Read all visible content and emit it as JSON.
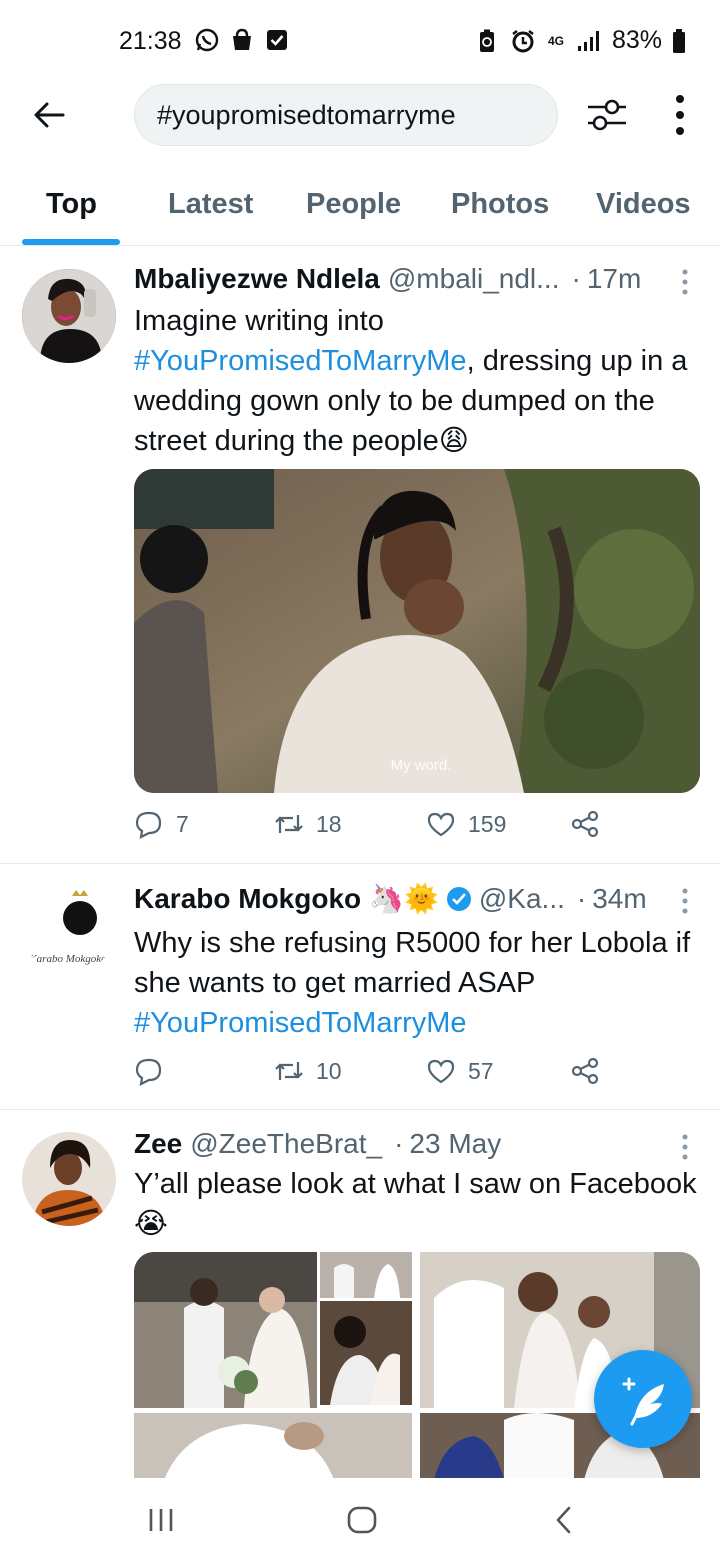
{
  "status_bar": {
    "time": "21:38",
    "network": "4G",
    "battery_text": "83%",
    "left_icons": [
      "whatsapp-icon",
      "shopping-bag-icon",
      "checkbox-icon"
    ],
    "right_icons": [
      "battery-saver-icon",
      "alarm-icon",
      "signal-icon",
      "battery-icon"
    ]
  },
  "search": {
    "query": "#youpromisedtomarryme"
  },
  "tabs": [
    {
      "label": "Top",
      "active": true
    },
    {
      "label": "Latest",
      "active": false
    },
    {
      "label": "People",
      "active": false
    },
    {
      "label": "Photos",
      "active": false
    },
    {
      "label": "Videos",
      "active": false
    }
  ],
  "tweets": [
    {
      "name": "Mbaliyezwe Ndlela",
      "handle": "@mbali_ndl...",
      "time": "17m",
      "text_pre": "Imagine writing into",
      "hashtag": "#YouPromisedToMarryMe",
      "text_post": ", dressing up in a wedding gown only to be dumped on the street during the people",
      "emoji": "😩",
      "media_caption": "My word.",
      "replies": "7",
      "retweets": "18",
      "likes": "159"
    },
    {
      "name": "Karabo Mokgoko",
      "name_emojis": "🦄🌞",
      "verified": true,
      "handle": "@Ka...",
      "time": "34m",
      "avatar_text": "Karabo Mokgoko",
      "text_pre": "Why is she refusing R5000 for her Lobola if she wants to get married ASAP",
      "hashtag": "#YouPromisedToMarryMe",
      "retweets": "10",
      "likes": "57"
    },
    {
      "name": "Zee",
      "handle": "@ZeeTheBrat_",
      "time": "23 May",
      "text_pre": "Y’all please look at what I saw on Facebook",
      "emoji": "😭"
    }
  ],
  "colors": {
    "accent": "#1d9bf0",
    "hashtag": "#1d8fde",
    "muted": "#536471"
  }
}
